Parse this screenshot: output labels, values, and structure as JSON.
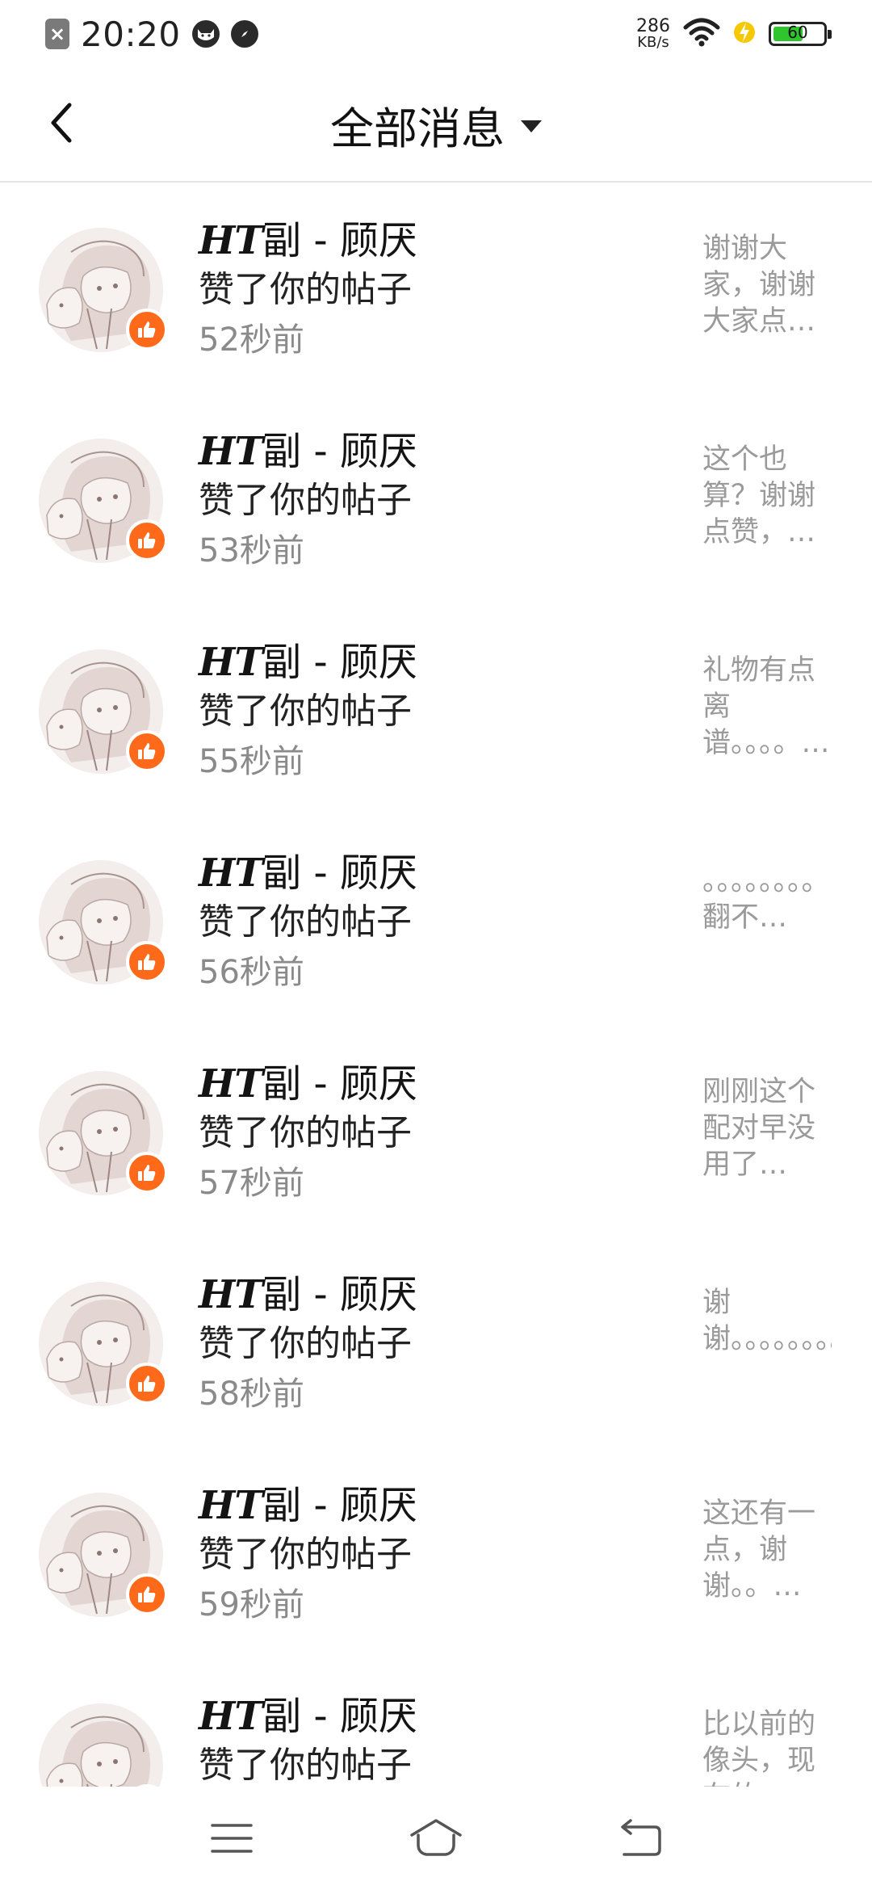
{
  "status_bar": {
    "time": "20:20",
    "net_speed_value": "286",
    "net_speed_unit": "KB/s",
    "battery_level": "60",
    "battery_fraction": 0.6
  },
  "header": {
    "title": "全部消息"
  },
  "messages": [
    {
      "name_prefix": "HT",
      "name_rest": "副 - 顾厌",
      "action": "赞了你的帖子",
      "time": "52秒前",
      "preview": "谢谢大家，谢谢大家点…"
    },
    {
      "name_prefix": "HT",
      "name_rest": "副 - 顾厌",
      "action": "赞了你的帖子",
      "time": "53秒前",
      "preview": "这个也算？谢谢点赞，…"
    },
    {
      "name_prefix": "HT",
      "name_rest": "副 - 顾厌",
      "action": "赞了你的帖子",
      "time": "55秒前",
      "preview": "礼物有点离谱。。。。…"
    },
    {
      "name_prefix": "HT",
      "name_rest": "副 - 顾厌",
      "action": "赞了你的帖子",
      "time": "56秒前",
      "preview": "。。。。。。。。翻不…"
    },
    {
      "name_prefix": "HT",
      "name_rest": "副 - 顾厌",
      "action": "赞了你的帖子",
      "time": "57秒前",
      "preview": "刚刚这个配对早没用了…"
    },
    {
      "name_prefix": "HT",
      "name_rest": "副 - 顾厌",
      "action": "赞了你的帖子",
      "time": "58秒前",
      "preview": "谢谢。。。。。。。。…"
    },
    {
      "name_prefix": "HT",
      "name_rest": "副 - 顾厌",
      "action": "赞了你的帖子",
      "time": "59秒前",
      "preview": "这还有一点，谢谢。。…"
    },
    {
      "name_prefix": "HT",
      "name_rest": "副 - 顾厌",
      "action": "赞了你的帖子",
      "time": "",
      "preview": "比以前的像头，现在的"
    }
  ],
  "icons": {
    "back": "chevron-left-icon",
    "dropdown": "caret-down-icon",
    "like": "thumbs-up-icon",
    "nav_menu": "menu-icon",
    "nav_home": "home-icon",
    "nav_back": "back-icon"
  },
  "colors": {
    "accent": "#ff6a1a",
    "battery": "#2ec52e",
    "secondary_text": "#8a8a8a"
  }
}
